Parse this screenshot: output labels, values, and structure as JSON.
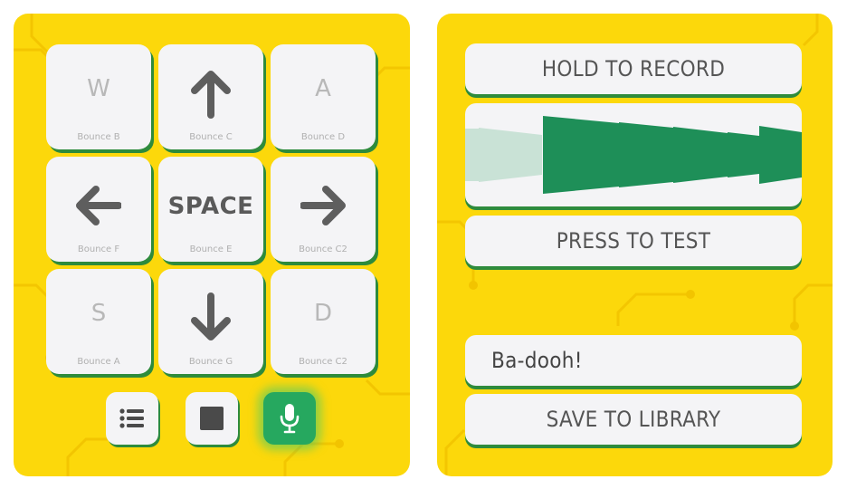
{
  "keypad": {
    "keys": [
      {
        "label": "W",
        "sub": "Bounce B"
      },
      {
        "label": "",
        "sub": "Bounce C",
        "icon": "arrow-up-icon"
      },
      {
        "label": "A",
        "sub": "Bounce D"
      },
      {
        "label": "",
        "sub": "Bounce F",
        "icon": "arrow-left-icon"
      },
      {
        "label": "SPACE",
        "sub": "Bounce E"
      },
      {
        "label": "",
        "sub": "Bounce C2",
        "icon": "arrow-right-icon"
      },
      {
        "label": "S",
        "sub": "Bounce A"
      },
      {
        "label": "",
        "sub": "Bounce G",
        "icon": "arrow-down-icon"
      },
      {
        "label": "D",
        "sub": "Bounce C2"
      }
    ]
  },
  "controls": {
    "list_icon": "list-icon",
    "stop_icon": "stop-icon",
    "mic_icon": "microphone-icon"
  },
  "recorder": {
    "record_label": "HOLD TO RECORD",
    "test_label": "PRESS TO TEST",
    "sound_name": "Ba-dooh!",
    "save_label": "SAVE TO LIBRARY"
  },
  "colors": {
    "panel": "#fcd80b",
    "accent_green": "#26a85f",
    "wave_green": "#1e8f58",
    "wave_light": "#c9e2d6"
  }
}
